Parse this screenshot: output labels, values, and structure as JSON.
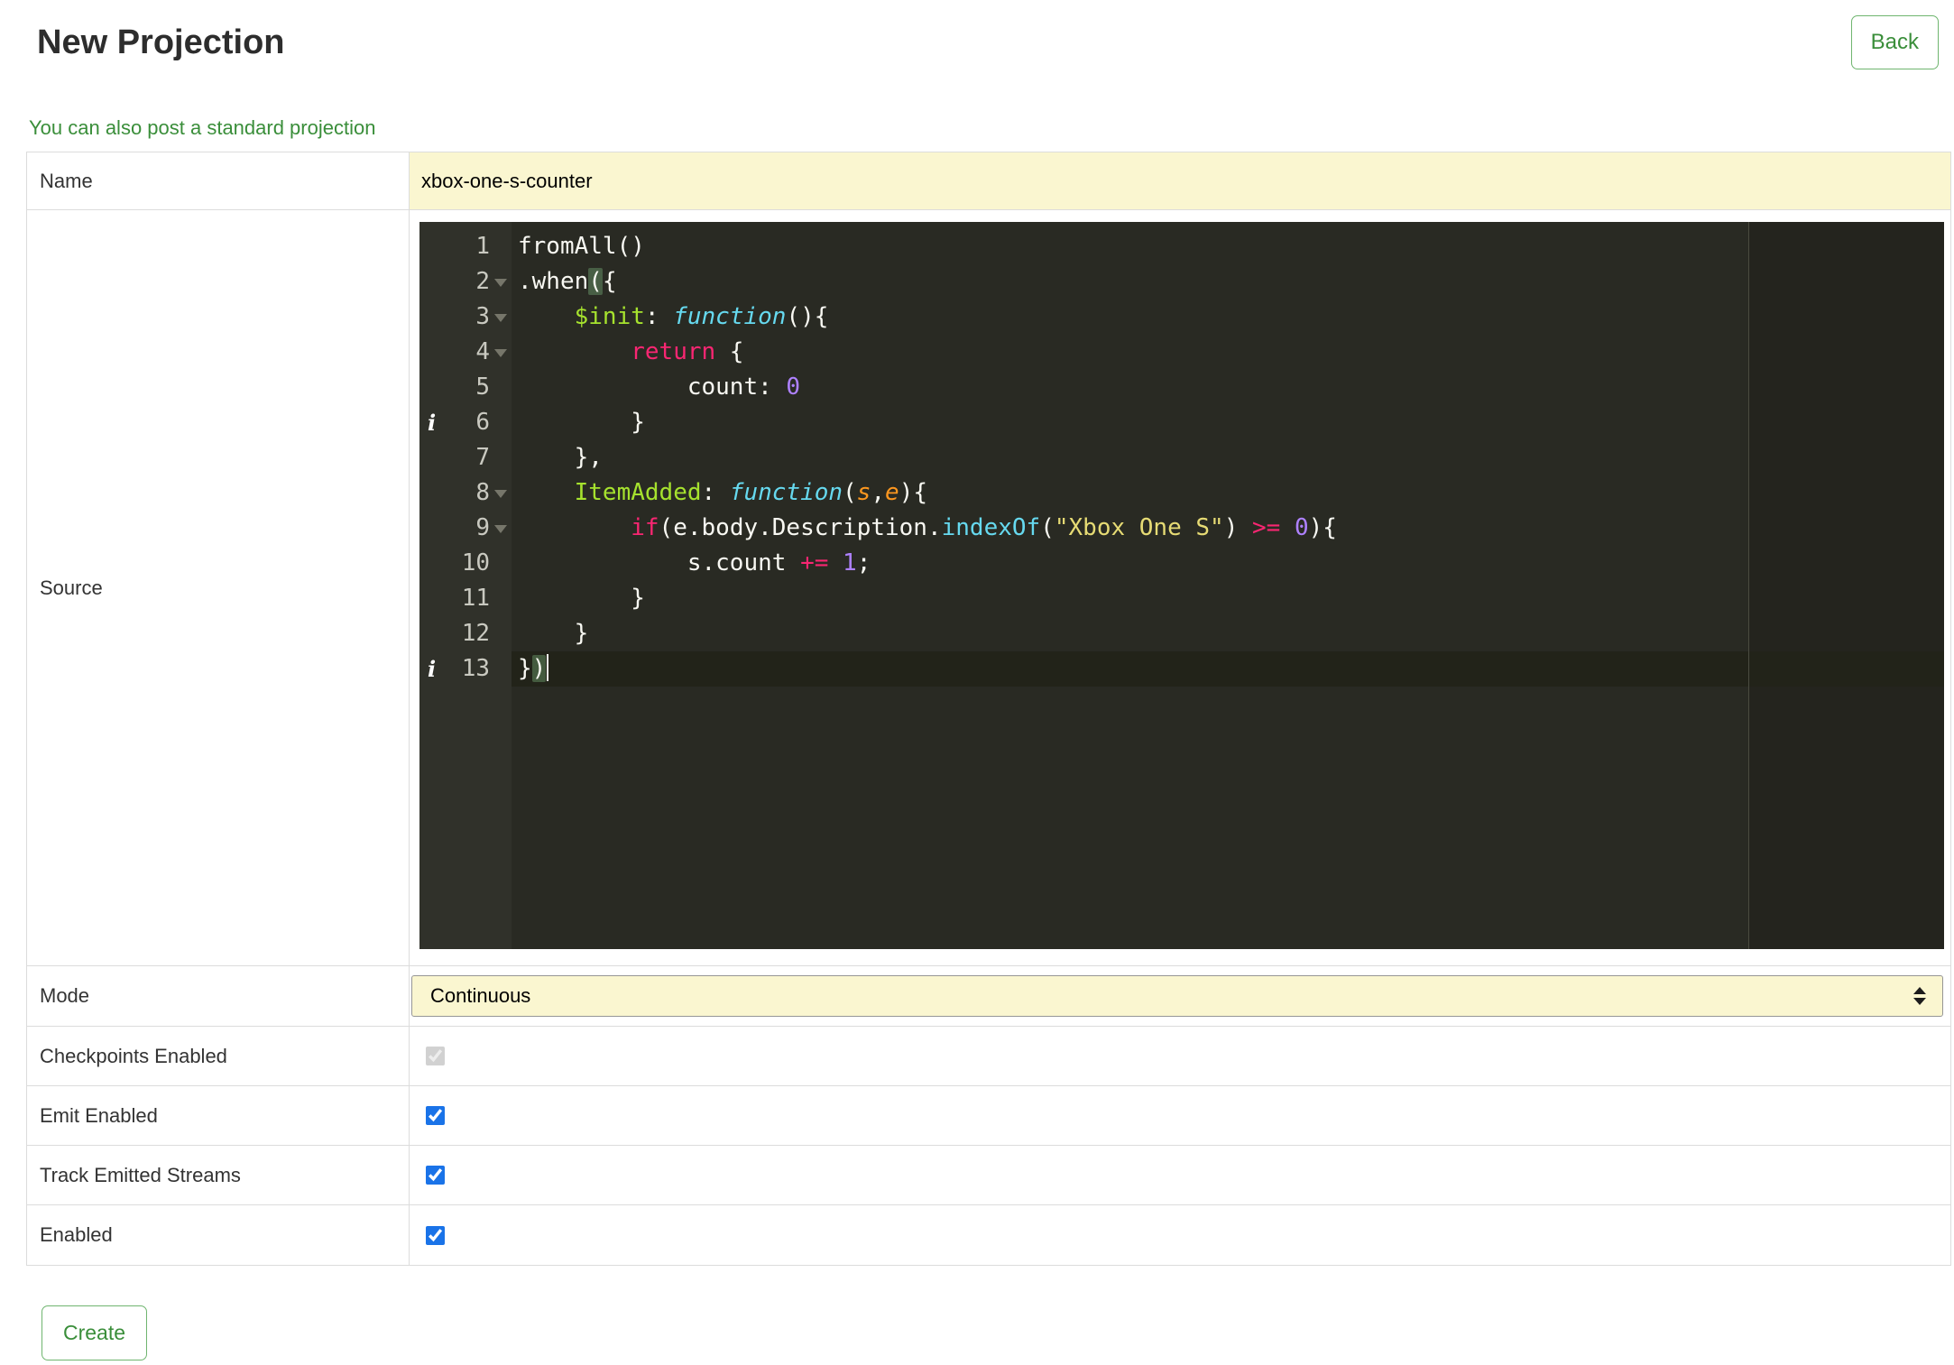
{
  "page": {
    "title": "New Projection",
    "back_label": "Back",
    "link_text": "You can also post a standard projection",
    "create_label": "Create"
  },
  "form": {
    "name_row": {
      "label": "Name",
      "value": "xbox-one-s-counter"
    },
    "source_row": {
      "label": "Source"
    },
    "mode_row": {
      "label": "Mode",
      "value": "Continuous"
    },
    "checkbox_rows": [
      {
        "label": "Checkpoints Enabled",
        "checked": true,
        "disabled": true
      },
      {
        "label": "Emit Enabled",
        "checked": true,
        "disabled": false
      },
      {
        "label": "Track Emitted Streams",
        "checked": true,
        "disabled": false
      },
      {
        "label": "Enabled",
        "checked": true,
        "disabled": false
      }
    ]
  },
  "editor": {
    "background": "#292a23",
    "gutter_background": "#30312a",
    "token_styles": {
      "p": {
        "color": "#f8f8f2"
      },
      "prop": {
        "color": "#a6e22e"
      },
      "kw": {
        "color": "#f92672"
      },
      "fnkw": {
        "color": "#66d9ef",
        "italic": true
      },
      "builtin": {
        "color": "#66d9ef"
      },
      "param": {
        "color": "#fd971f",
        "italic": true
      },
      "num": {
        "color": "#ae81ff"
      },
      "str": {
        "color": "#e6db74"
      },
      "match": {
        "color": "#f8f8f2",
        "matched": true
      }
    },
    "lines": [
      {
        "num": 1,
        "fold": false,
        "info": false,
        "active": false,
        "tokens": [
          {
            "t": "fromAll()",
            "c": "p"
          }
        ]
      },
      {
        "num": 2,
        "fold": true,
        "info": false,
        "active": false,
        "tokens": [
          {
            "t": ".when",
            "c": "p"
          },
          {
            "t": "(",
            "c": "match"
          },
          {
            "t": "{",
            "c": "p"
          }
        ]
      },
      {
        "num": 3,
        "fold": true,
        "info": false,
        "active": false,
        "tokens": [
          {
            "t": "    ",
            "c": "p"
          },
          {
            "t": "$init",
            "c": "prop"
          },
          {
            "t": ": ",
            "c": "p"
          },
          {
            "t": "function",
            "c": "fnkw"
          },
          {
            "t": "(){",
            "c": "p"
          }
        ]
      },
      {
        "num": 4,
        "fold": true,
        "info": false,
        "active": false,
        "tokens": [
          {
            "t": "        ",
            "c": "p"
          },
          {
            "t": "return",
            "c": "kw"
          },
          {
            "t": " {",
            "c": "p"
          }
        ]
      },
      {
        "num": 5,
        "fold": false,
        "info": false,
        "active": false,
        "tokens": [
          {
            "t": "            count: ",
            "c": "p"
          },
          {
            "t": "0",
            "c": "num"
          }
        ]
      },
      {
        "num": 6,
        "fold": false,
        "info": true,
        "active": false,
        "tokens": [
          {
            "t": "        }",
            "c": "p"
          }
        ]
      },
      {
        "num": 7,
        "fold": false,
        "info": false,
        "active": false,
        "tokens": [
          {
            "t": "    },",
            "c": "p"
          }
        ]
      },
      {
        "num": 8,
        "fold": true,
        "info": false,
        "active": false,
        "tokens": [
          {
            "t": "    ",
            "c": "p"
          },
          {
            "t": "ItemAdded",
            "c": "prop"
          },
          {
            "t": ": ",
            "c": "p"
          },
          {
            "t": "function",
            "c": "fnkw"
          },
          {
            "t": "(",
            "c": "p"
          },
          {
            "t": "s",
            "c": "param"
          },
          {
            "t": ",",
            "c": "p"
          },
          {
            "t": "e",
            "c": "param"
          },
          {
            "t": "){",
            "c": "p"
          }
        ]
      },
      {
        "num": 9,
        "fold": true,
        "info": false,
        "active": false,
        "tokens": [
          {
            "t": "        ",
            "c": "p"
          },
          {
            "t": "if",
            "c": "kw"
          },
          {
            "t": "(e.body.Description.",
            "c": "p"
          },
          {
            "t": "indexOf",
            "c": "builtin"
          },
          {
            "t": "(",
            "c": "p"
          },
          {
            "t": "\"Xbox One S\"",
            "c": "str"
          },
          {
            "t": ") ",
            "c": "p"
          },
          {
            "t": ">=",
            "c": "kw"
          },
          {
            "t": " ",
            "c": "p"
          },
          {
            "t": "0",
            "c": "num"
          },
          {
            "t": "){",
            "c": "p"
          }
        ]
      },
      {
        "num": 10,
        "fold": false,
        "info": false,
        "active": false,
        "tokens": [
          {
            "t": "            s.count ",
            "c": "p"
          },
          {
            "t": "+=",
            "c": "kw"
          },
          {
            "t": " ",
            "c": "p"
          },
          {
            "t": "1",
            "c": "num"
          },
          {
            "t": ";",
            "c": "p"
          }
        ]
      },
      {
        "num": 11,
        "fold": false,
        "info": false,
        "active": false,
        "tokens": [
          {
            "t": "        }",
            "c": "p"
          }
        ]
      },
      {
        "num": 12,
        "fold": false,
        "info": false,
        "active": false,
        "tokens": [
          {
            "t": "    }",
            "c": "p"
          }
        ]
      },
      {
        "num": 13,
        "fold": false,
        "info": true,
        "active": true,
        "cursor": true,
        "tokens": [
          {
            "t": "}",
            "c": "p"
          },
          {
            "t": ")",
            "c": "match"
          }
        ]
      }
    ]
  }
}
